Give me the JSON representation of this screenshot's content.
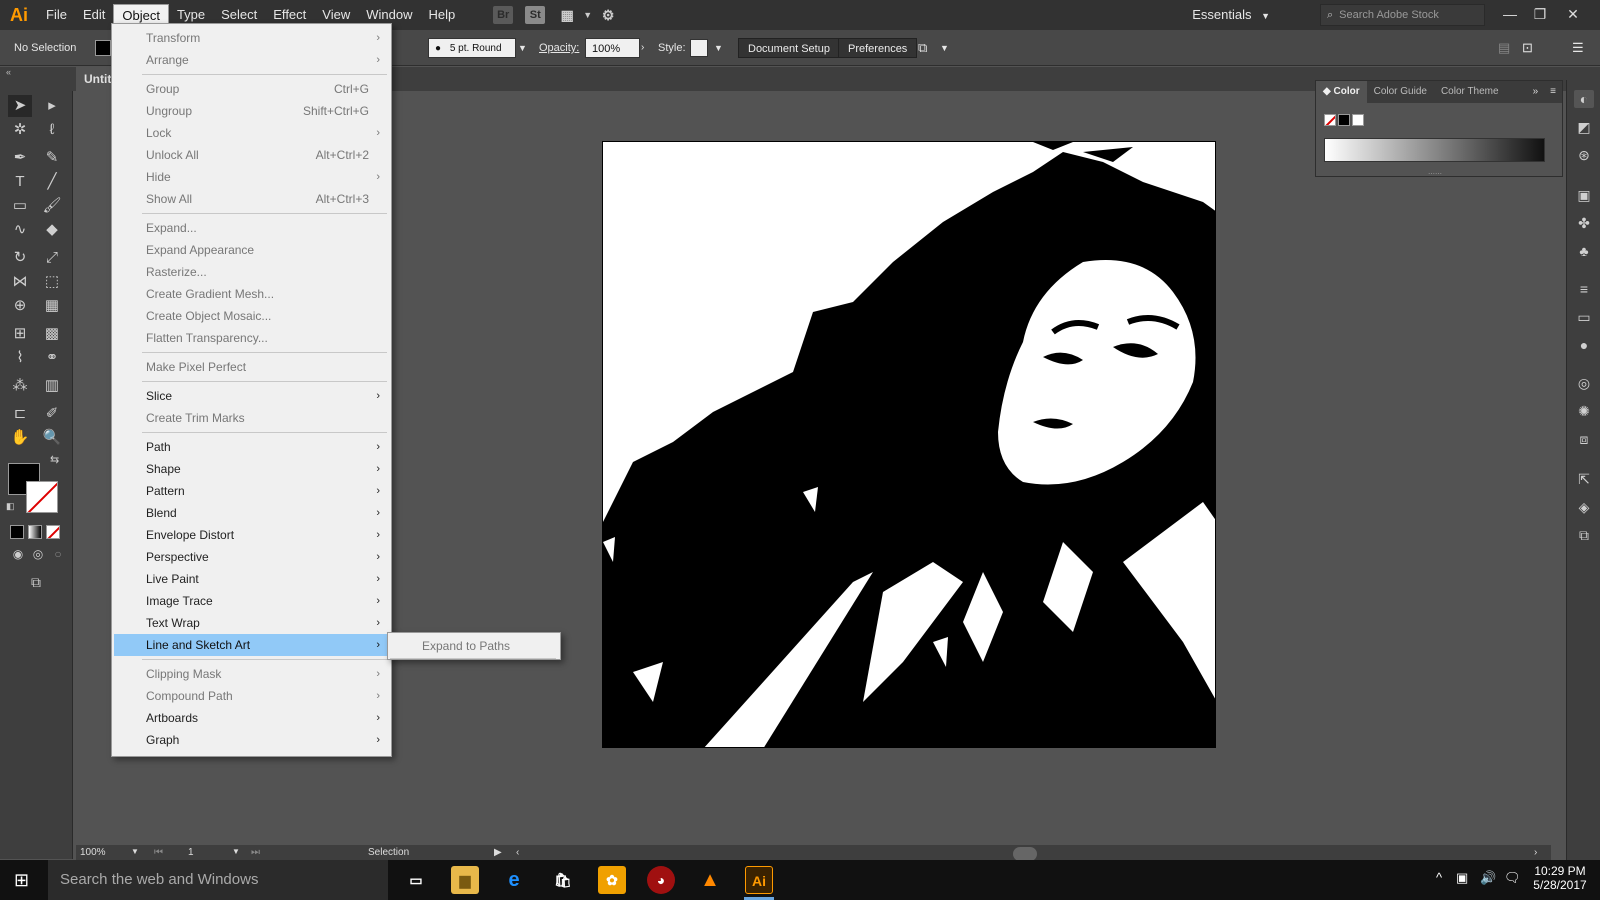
{
  "app": {
    "logo": "Ai"
  },
  "menubar": {
    "items": [
      "File",
      "Edit",
      "Object",
      "Type",
      "Select",
      "Effect",
      "View",
      "Window",
      "Help"
    ],
    "active": "Object",
    "bridge_label": "Br",
    "stock_label": "St",
    "workspace": "Essentials",
    "search_placeholder": "Search Adobe Stock"
  },
  "controlbar": {
    "selection": "No Selection",
    "stroke_profile": "5 pt. Round",
    "opacity_label": "Opacity:",
    "opacity_value": "100%",
    "style_label": "Style:",
    "document_setup": "Document Setup",
    "preferences": "Preferences"
  },
  "document": {
    "tab_title": "Untitled"
  },
  "object_menu": {
    "items": [
      {
        "label": "Transform",
        "shortcut": "",
        "submenu": true,
        "disabled": true
      },
      {
        "label": "Arrange",
        "shortcut": "",
        "submenu": true,
        "disabled": true
      },
      {
        "sep": true
      },
      {
        "label": "Group",
        "shortcut": "Ctrl+G",
        "submenu": false,
        "disabled": true
      },
      {
        "label": "Ungroup",
        "shortcut": "Shift+Ctrl+G",
        "submenu": false,
        "disabled": true
      },
      {
        "label": "Lock",
        "shortcut": "",
        "submenu": true,
        "disabled": true
      },
      {
        "label": "Unlock All",
        "shortcut": "Alt+Ctrl+2",
        "submenu": false,
        "disabled": true
      },
      {
        "label": "Hide",
        "shortcut": "",
        "submenu": true,
        "disabled": true
      },
      {
        "label": "Show All",
        "shortcut": "Alt+Ctrl+3",
        "submenu": false,
        "disabled": true
      },
      {
        "sep": true
      },
      {
        "label": "Expand...",
        "shortcut": "",
        "submenu": false,
        "disabled": true
      },
      {
        "label": "Expand Appearance",
        "shortcut": "",
        "submenu": false,
        "disabled": true
      },
      {
        "label": "Rasterize...",
        "shortcut": "",
        "submenu": false,
        "disabled": true
      },
      {
        "label": "Create Gradient Mesh...",
        "shortcut": "",
        "submenu": false,
        "disabled": true
      },
      {
        "label": "Create Object Mosaic...",
        "shortcut": "",
        "submenu": false,
        "disabled": true
      },
      {
        "label": "Flatten Transparency...",
        "shortcut": "",
        "submenu": false,
        "disabled": true
      },
      {
        "sep": true
      },
      {
        "label": "Make Pixel Perfect",
        "shortcut": "",
        "submenu": false,
        "disabled": true
      },
      {
        "sep": true
      },
      {
        "label": "Slice",
        "shortcut": "",
        "submenu": true,
        "disabled": false
      },
      {
        "label": "Create Trim Marks",
        "shortcut": "",
        "submenu": false,
        "disabled": true
      },
      {
        "sep": true
      },
      {
        "label": "Path",
        "shortcut": "",
        "submenu": true,
        "disabled": false
      },
      {
        "label": "Shape",
        "shortcut": "",
        "submenu": true,
        "disabled": false
      },
      {
        "label": "Pattern",
        "shortcut": "",
        "submenu": true,
        "disabled": false
      },
      {
        "label": "Blend",
        "shortcut": "",
        "submenu": true,
        "disabled": false
      },
      {
        "label": "Envelope Distort",
        "shortcut": "",
        "submenu": true,
        "disabled": false
      },
      {
        "label": "Perspective",
        "shortcut": "",
        "submenu": true,
        "disabled": false
      },
      {
        "label": "Live Paint",
        "shortcut": "",
        "submenu": true,
        "disabled": false
      },
      {
        "label": "Image Trace",
        "shortcut": "",
        "submenu": true,
        "disabled": false
      },
      {
        "label": "Text Wrap",
        "shortcut": "",
        "submenu": true,
        "disabled": false
      },
      {
        "label": "Line and Sketch Art",
        "shortcut": "",
        "submenu": true,
        "disabled": false,
        "highlighted": true
      },
      {
        "sep": true
      },
      {
        "label": "Clipping Mask",
        "shortcut": "",
        "submenu": true,
        "disabled": true
      },
      {
        "label": "Compound Path",
        "shortcut": "",
        "submenu": true,
        "disabled": true
      },
      {
        "label": "Artboards",
        "shortcut": "",
        "submenu": true,
        "disabled": false
      },
      {
        "label": "Graph",
        "shortcut": "",
        "submenu": true,
        "disabled": false
      }
    ]
  },
  "submenu": {
    "items": [
      "Expand to Paths"
    ]
  },
  "color_panel": {
    "tabs": [
      "Color",
      "Color Guide",
      "Color Theme"
    ],
    "active_tab": "Color"
  },
  "statusbar": {
    "zoom": "100%",
    "artboard": "1",
    "tool": "Selection"
  },
  "taskbar": {
    "search": "Search the web and Windows",
    "time": "10:29 PM",
    "date": "5/28/2017"
  },
  "toolbar_tools": [
    "selection-tool",
    "direct-selection-tool",
    "magic-wand-tool",
    "lasso-tool",
    "pen-tool",
    "curvature-tool",
    "type-tool",
    "line-tool",
    "rectangle-tool",
    "paintbrush-tool",
    "shaper-tool",
    "eraser-tool",
    "rotate-tool",
    "scale-tool",
    "width-tool",
    "free-transform-tool",
    "shape-builder-tool",
    "perspective-grid-tool",
    "mesh-tool",
    "gradient-tool",
    "eyedropper-tool",
    "blend-tool",
    "symbol-sprayer-tool",
    "column-graph-tool",
    "artboard-tool",
    "slice-tool",
    "hand-tool",
    "zoom-tool"
  ]
}
